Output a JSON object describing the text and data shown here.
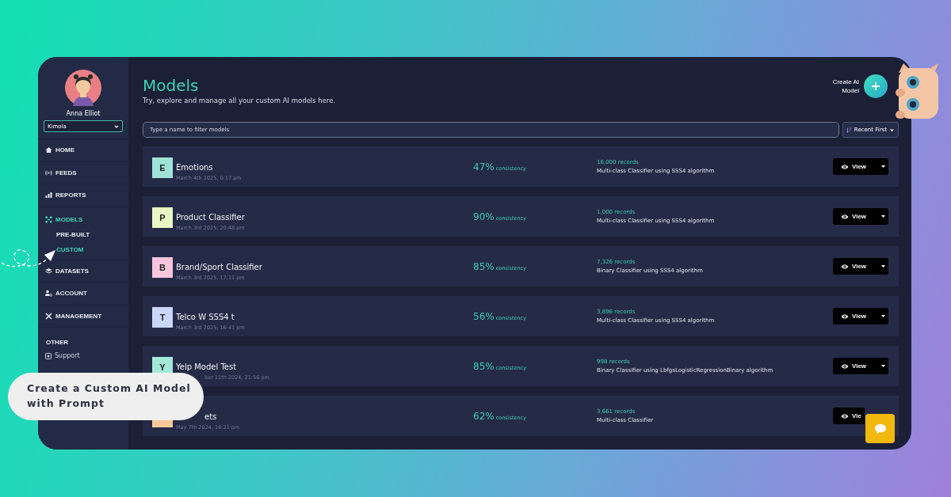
{
  "profile": {
    "name": "Anna Elliot",
    "workspace": "Kimola"
  },
  "sidebar": {
    "items": [
      {
        "label": "HOME",
        "selected": false
      },
      {
        "label": "FEEDS",
        "selected": false
      },
      {
        "label": "REPORTS",
        "selected": false
      },
      {
        "label": "MODELS",
        "selected": true,
        "children": [
          {
            "label": "PRE-BUILT",
            "selected": false
          },
          {
            "label": "CUSTOM",
            "selected": true
          }
        ]
      },
      {
        "label": "DATASETS",
        "selected": false
      },
      {
        "label": "ACCOUNT",
        "selected": false
      },
      {
        "label": "MANAGEMENT",
        "selected": false
      }
    ],
    "section": "OTHER",
    "links": [
      {
        "label": "Support"
      }
    ]
  },
  "header": {
    "title": "Models",
    "subtitle": "Try, explore and manage all your custom AI models here.",
    "create_button": "Create AI Model"
  },
  "filter": {
    "placeholder": "Type a name to filter models"
  },
  "sort": {
    "label": "Recent First"
  },
  "models": [
    {
      "initial": "E",
      "color": "#9fe3d6",
      "name": "Emotions",
      "date": "March 4th 2025, 0:17 am",
      "consistency": "47%",
      "consistency_label": "consistency",
      "records": "16,000 records",
      "description": "Multi-class Classifier using SSS4 algorithm",
      "button": "View",
      "dropdown": true
    },
    {
      "initial": "P",
      "color": "#eaf8c4",
      "name": "Product Classifier",
      "date": "March 3rd 2025, 20:48 pm",
      "consistency": "90%",
      "consistency_label": "consistency",
      "records": "1,000 records",
      "description": "Multi-class Classifier using SSS4 algorithm",
      "button": "View",
      "dropdown": true
    },
    {
      "initial": "B",
      "color": "#f7c6dc",
      "name": "Brand/Sport Classifier",
      "date": "March 3rd 2025, 17:11 pm",
      "consistency": "85%",
      "consistency_label": "consistency",
      "records": "7,326 records",
      "description": "Binary Classifier using SSS4 algorithm",
      "button": "View",
      "dropdown": true
    },
    {
      "initial": "T",
      "color": "#c9d6f7",
      "name": "Telco W SSS4 t",
      "date": "March 3rd 2025, 16:41 pm",
      "consistency": "56%",
      "consistency_label": "consistency",
      "records": "3,896 records",
      "description": "Multi-class Classifier using SSS4 algorithm",
      "button": "View",
      "dropdown": true
    },
    {
      "initial": "Y",
      "color": "#a4e8d8",
      "name": "Yelp Model Test",
      "date": "ber 11th 2024, 21:56 pm",
      "date_covered": true,
      "consistency": "85%",
      "consistency_label": "consistency",
      "records": "998 records",
      "description": "Binary Classifier using LbfgsLogisticRegressionBinary algorithm",
      "button": "View",
      "dropdown": true
    },
    {
      "color": "#f9c99a",
      "name": "ets",
      "name_covered": true,
      "date": "May 7th 2024, 16:21 pm",
      "consistency": "62%",
      "consistency_label": "consistency",
      "records": "3,661 records",
      "description": "Multi-class Classifier",
      "button": "Vie",
      "dropdown": false
    }
  ],
  "callout": "Create a Custom AI Model with Prompt"
}
